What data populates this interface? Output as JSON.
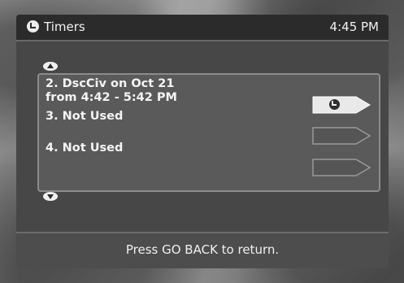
{
  "window": {
    "title": "Timers",
    "time": "4:45 PM",
    "title_icon": "timer-clock-icon"
  },
  "list": {
    "scroll_up_icon": "scroll-up-arrow-icon",
    "scroll_down_icon": "scroll-down-arrow-icon",
    "items": [
      {
        "label_line1": "2. DscCiv on Oct 21",
        "label_line2": "from 4:42 - 5:42 PM",
        "selected": true,
        "tag_icon": "timer-clock-icon"
      },
      {
        "label_line1": "3. Not Used",
        "label_line2": "",
        "selected": false
      },
      {
        "label_line1": "4. Not Used",
        "label_line2": "",
        "selected": false
      }
    ]
  },
  "footer": {
    "message": "Press GO BACK to return."
  },
  "colors": {
    "panel": "#474747",
    "titlebar": "#2b2b2b",
    "selected_tag": "#e9e9e9",
    "text": "#f4f4f4"
  }
}
